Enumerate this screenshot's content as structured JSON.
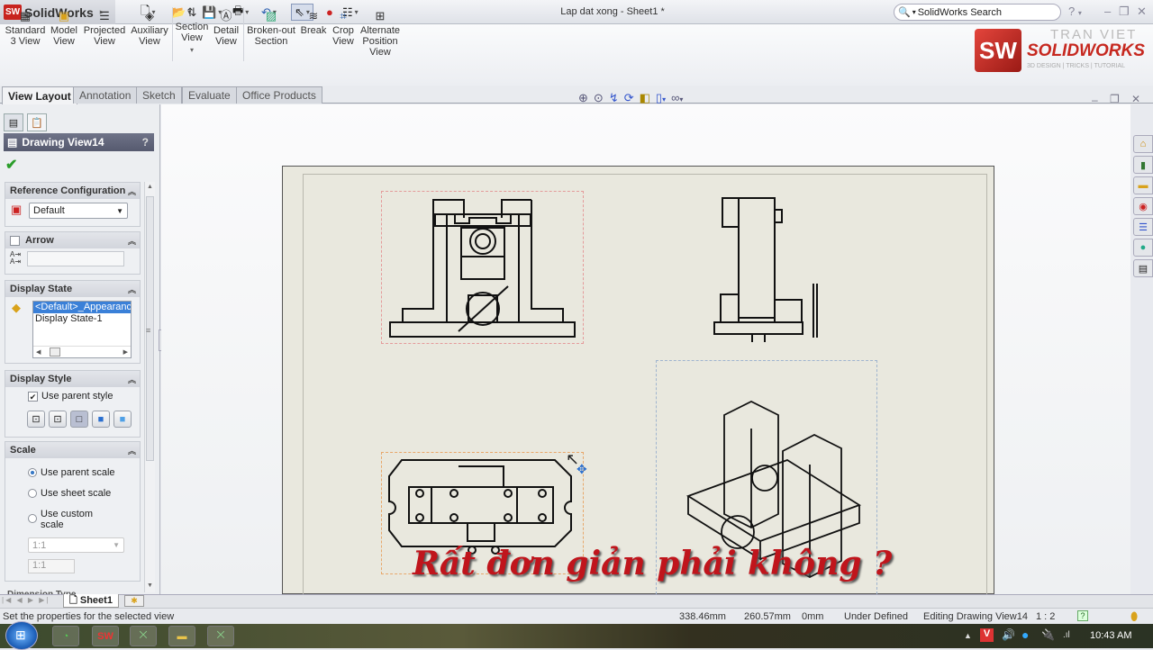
{
  "app": {
    "name": "SolidWorks",
    "document_title": "Lap dat xong - Sheet1 *",
    "search_placeholder": "SolidWorks Search"
  },
  "quick_access": [
    "new-icon",
    "open-icon",
    "save-icon",
    "print-icon",
    "undo-icon",
    "select-icon",
    "rebuild-icon",
    "options-icon"
  ],
  "ribbon": {
    "buttons": [
      {
        "label": "Standard 3 View",
        "icon": "standard-3-view-icon"
      },
      {
        "label": "Model View",
        "icon": "model-view-icon"
      },
      {
        "label": "Projected View",
        "icon": "projected-view-icon"
      },
      {
        "label": "Auxiliary View",
        "icon": "auxiliary-view-icon"
      },
      {
        "label": "Section View",
        "icon": "section-view-icon"
      },
      {
        "label": "Detail View",
        "icon": "detail-view-icon"
      },
      {
        "label": "Broken-out Section",
        "icon": "broken-out-section-icon"
      },
      {
        "label": "Break",
        "icon": "break-icon"
      },
      {
        "label": "Crop View",
        "icon": "crop-view-icon"
      },
      {
        "label": "Alternate Position View",
        "icon": "alternate-position-view-icon"
      }
    ],
    "brand": {
      "line1": "TRAN VIET",
      "line2": "SOLIDWORKS",
      "line3": "3D DESIGN | TRICKS | TUTORIAL"
    }
  },
  "tabs": [
    {
      "label": "View Layout",
      "active": true
    },
    {
      "label": "Annotation",
      "active": false
    },
    {
      "label": "Sketch",
      "active": false
    },
    {
      "label": "Evaluate",
      "active": false
    },
    {
      "label": "Office Products",
      "active": false
    }
  ],
  "property_manager": {
    "title": "Drawing View14",
    "help": "?",
    "reference_configuration": {
      "header": "Reference Configuration",
      "value": "Default"
    },
    "arrow": {
      "header": "Arrow",
      "checked": false,
      "label_value": ""
    },
    "display_state": {
      "header": "Display State",
      "items": [
        "<Default>_Appearance",
        "Display State-1"
      ],
      "selected": 0
    },
    "display_style": {
      "header": "Display Style",
      "use_parent_label": "Use parent style",
      "use_parent_checked": true,
      "styles": [
        "wireframe",
        "hidden-lines-visible",
        "hidden-lines-removed",
        "shaded-with-edges",
        "shaded"
      ]
    },
    "scale": {
      "header": "Scale",
      "options": [
        "Use parent scale",
        "Use sheet scale",
        "Use custom scale"
      ],
      "selected": 0,
      "custom_value": "1:1",
      "custom_input": "1:1"
    },
    "next_group": "Dimension Type"
  },
  "view_toolbar": [
    "zoom-to-fit-icon",
    "zoom-to-area-icon",
    "previous-view-icon",
    "rebuild-icon",
    "hide-show-icon",
    "view-orientation-icon",
    "display-style-icon"
  ],
  "task_pane": [
    "home-icon",
    "design-library-icon",
    "file-explorer-icon",
    "view-palette-icon",
    "appearances-icon",
    "custom-properties-icon",
    "document-recovery-icon"
  ],
  "overlay_caption": "Rất đơn giản phải không ?",
  "sheet_tabs": {
    "active": "Sheet1"
  },
  "status": {
    "message": "Set the properties for the selected view",
    "x": "338.46mm",
    "y": "260.57mm",
    "z": "0mm",
    "definition": "Under Defined",
    "editing": "Editing Drawing View14",
    "scale": "1 : 2"
  },
  "taskbar": {
    "clock": "10:43 AM"
  }
}
